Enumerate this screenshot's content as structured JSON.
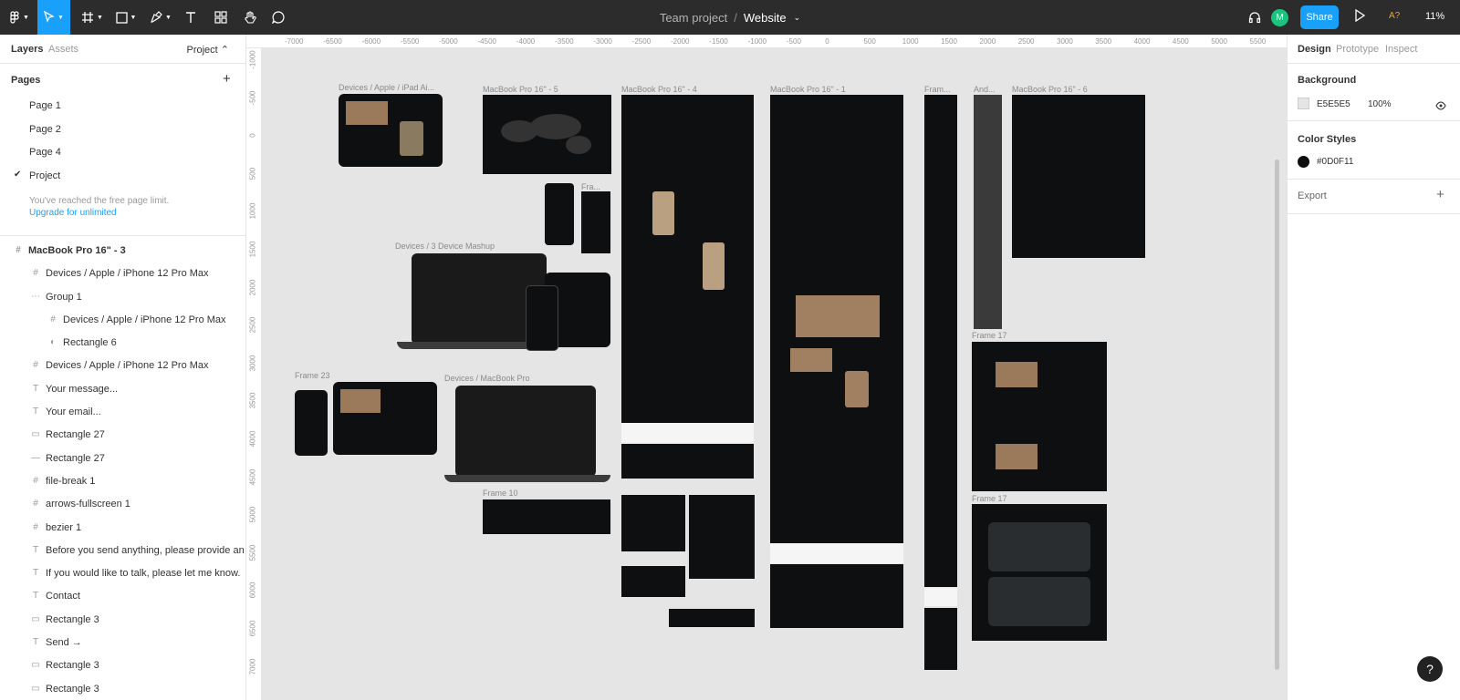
{
  "toolbar": {
    "project": "Team project",
    "file": "Website",
    "avatar_initial": "M",
    "share_label": "Share",
    "spell": "A?",
    "zoom": "11%"
  },
  "left_panel": {
    "tabs": {
      "layers": "Layers",
      "assets": "Assets",
      "project": "Project ⌃"
    },
    "pages_label": "Pages",
    "pages": [
      "Page 1",
      "Page 2",
      "Page 4",
      "Project"
    ],
    "current_page": "Project",
    "limit_text": "You've reached the free page limit.",
    "upgrade_link": "Upgrade for unlimited",
    "layers": [
      {
        "icon": "#",
        "label": "MacBook Pro 16\" - 3",
        "indent": 0
      },
      {
        "icon": "#",
        "label": "Devices / Apple / iPhone 12 Pro Max",
        "indent": 1
      },
      {
        "icon": "⋯",
        "label": "Group 1",
        "indent": 1
      },
      {
        "icon": "#",
        "label": "Devices / Apple / iPhone 12 Pro Max",
        "indent": 2
      },
      {
        "icon": "◐",
        "label": "Rectangle 6",
        "indent": 2
      },
      {
        "icon": "#",
        "label": "Devices / Apple / iPhone 12 Pro Max",
        "indent": 1
      },
      {
        "icon": "T",
        "label": "Your message...",
        "indent": 1
      },
      {
        "icon": "T",
        "label": "Your email...",
        "indent": 1
      },
      {
        "icon": "▭",
        "label": "Rectangle 27",
        "indent": 1
      },
      {
        "icon": "—",
        "label": "Rectangle 27",
        "indent": 1
      },
      {
        "icon": "#",
        "label": "file-break 1",
        "indent": 1
      },
      {
        "icon": "#",
        "label": "arrows-fullscreen 1",
        "indent": 1
      },
      {
        "icon": "#",
        "label": "bezier 1",
        "indent": 1
      },
      {
        "icon": "T",
        "label": "Before you send anything, please provide an em...",
        "indent": 1
      },
      {
        "icon": "T",
        "label": "If you would like to talk, please let me know.",
        "indent": 1
      },
      {
        "icon": "T",
        "label": "Contact",
        "indent": 1
      },
      {
        "icon": "▭",
        "label": "Rectangle 3",
        "indent": 1
      },
      {
        "icon": "T",
        "label": "Send →",
        "indent": 1
      },
      {
        "icon": "▭",
        "label": "Rectangle 3",
        "indent": 1
      },
      {
        "icon": "▭",
        "label": "Rectangle 3",
        "indent": 1
      }
    ]
  },
  "ruler": {
    "x_ticks": [
      "-7000",
      "-6500",
      "-6000",
      "-5500",
      "-5000",
      "-4500",
      "-4000",
      "-3500",
      "-3000",
      "-2500",
      "-2000",
      "-1500",
      "-1000",
      "-500",
      "0",
      "500",
      "1000",
      "1500",
      "2000",
      "2500",
      "3000",
      "3500",
      "4000",
      "4500",
      "5000",
      "5500"
    ],
    "y_ticks": [
      "-1000",
      "-500",
      "0",
      "500",
      "1000",
      "1500",
      "2000",
      "2500",
      "3000",
      "3500",
      "4000",
      "4500",
      "5000",
      "5500",
      "6000",
      "6500",
      "7000"
    ]
  },
  "canvas": {
    "frame_labels": [
      "Devices / Apple / iPad Ai...",
      "MacBook Pro 16\" - 5",
      "MacBook Pro 16\" - 4",
      "MacBook Pro 16\" - 1",
      "Fram...",
      "And...",
      "MacBook Pro 16\" - 6",
      "Fra...",
      "Devices / 3 Device Mashup",
      "Frame 23",
      "Devices / MacBook Pro",
      "Frame 10",
      "Frame 17",
      "Frame 17"
    ]
  },
  "right_panel": {
    "tabs": {
      "design": "Design",
      "prototype": "Prototype",
      "inspect": "Inspect"
    },
    "background_label": "Background",
    "bg_hex": "E5E5E5",
    "bg_opacity": "100%",
    "color_styles_label": "Color Styles",
    "color_style_hex": "#0D0F11",
    "export_label": "Export",
    "help": "?"
  },
  "colors": {
    "accent": "#18a0fb",
    "toolbar_bg": "#2c2c2c",
    "canvas_bg": "#E5E5E5",
    "frame_bg": "#0D0F11"
  }
}
